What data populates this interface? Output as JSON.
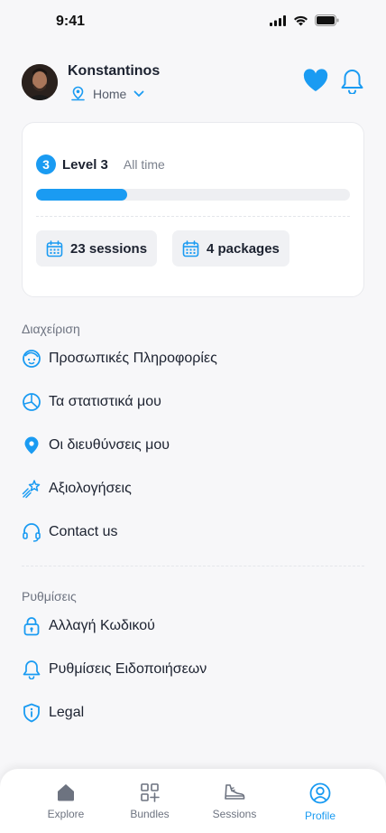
{
  "status_bar": {
    "time": "9:41"
  },
  "profile": {
    "name": "Konstantinos",
    "location": "Home"
  },
  "level_card": {
    "badge": "3",
    "level_label": "Level 3",
    "period": "All time",
    "progress": 0.29,
    "sessions": "23 sessions",
    "packages": "4 packages"
  },
  "management": {
    "title": "Διαχείριση",
    "items": [
      {
        "label": "Προσωπικές Πληροφορίες",
        "icon": "face-icon"
      },
      {
        "label": "Τα στατιστικά μου",
        "icon": "pie-chart-icon"
      },
      {
        "label": "Οι διευθύνσεις μου",
        "icon": "location-pin-icon"
      },
      {
        "label": "Αξιολογήσεις",
        "icon": "stars-icon"
      },
      {
        "label": "Contact us",
        "icon": "headset-icon"
      }
    ]
  },
  "settings": {
    "title": "Ρυθμίσεις",
    "items": [
      {
        "label": "Αλλαγή Κωδικού",
        "icon": "lock-icon"
      },
      {
        "label": "Ρυθμίσεις Ειδοποιήσεων",
        "icon": "bell-icon"
      },
      {
        "label": "Legal",
        "icon": "shield-info-icon"
      }
    ]
  },
  "bottom_nav": {
    "items": [
      {
        "label": "Explore",
        "icon": "home-icon",
        "active": false
      },
      {
        "label": "Bundles",
        "icon": "grid-plus-icon",
        "active": false
      },
      {
        "label": "Sessions",
        "icon": "sneaker-icon",
        "active": false
      },
      {
        "label": "Profile",
        "icon": "user-circle-icon",
        "active": true
      }
    ]
  },
  "colors": {
    "accent": "#1a9bf2",
    "background": "#f7f7f9",
    "text": "#1c2230"
  }
}
